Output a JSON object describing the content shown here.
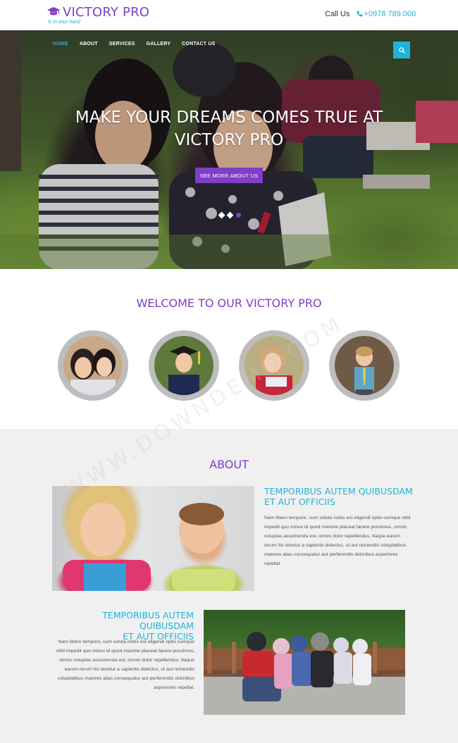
{
  "header": {
    "logo_title": "VICTORY PRO",
    "logo_tagline": "Is in your hand",
    "call_label": "Call Us",
    "call_phone": "+0978 789 000"
  },
  "nav": {
    "items": [
      {
        "label": "HOME",
        "active": true
      },
      {
        "label": "ABOUT",
        "active": false
      },
      {
        "label": "SERVICES",
        "active": false
      },
      {
        "label": "GALLERY",
        "active": false
      },
      {
        "label": "CONTACT US",
        "active": false
      }
    ],
    "search_icon": "search-icon"
  },
  "hero": {
    "title_line1": "MAKE YOUR DREAMS COMES TRUE AT",
    "title_line2": "VICTORY PRO",
    "button_label": "SEE MORE ABOUT US",
    "slides_total": 3,
    "active_slide": 3
  },
  "welcome": {
    "title": "WELCOME TO OUR VICTORY PRO"
  },
  "about": {
    "title": "ABOUT",
    "blocks": [
      {
        "title_line1": "TEMPORIBUS AUTEM QUIBUSDAM",
        "title_line2": "ET AUT OFFICIIS",
        "text": "Nam libero tempore, cum soluta nobis est eligendi optio cumque nihil impedit quo minus id quod maxime placeat facere possimus, omnis voluptas assumenda est, omnis dolor repellendus. Itaque earum rerum hic tenetur a sapiente delectus, ut aut reiciendis voluptatibus maiores alias consequatur aut perferendis doloribus asperiores repellat."
      },
      {
        "title_line1": "TEMPORIBUS AUTEM QUIBUSDAM",
        "title_line2": "ET AUT OFFICIIS",
        "text": "Nam libero tempore, cum soluta nobis est eligendi optio cumque nihil impedit quo minus id quod maxime placeat facere possimus, omnis voluptas assumenda est, omnis dolor repellendus. Itaque earum rerum hic tenetur a sapiente delectus, ut aut reiciendis voluptatibus maiores alias consequatur aut perferendis doloribus asperiores repellat."
      }
    ]
  },
  "watermark": "WWW.DOWNDEMO.COM",
  "colors": {
    "brand_purple": "#7f3fc7",
    "accent_cyan": "#1fb3d8",
    "section_gray": "#f0f0f0"
  }
}
